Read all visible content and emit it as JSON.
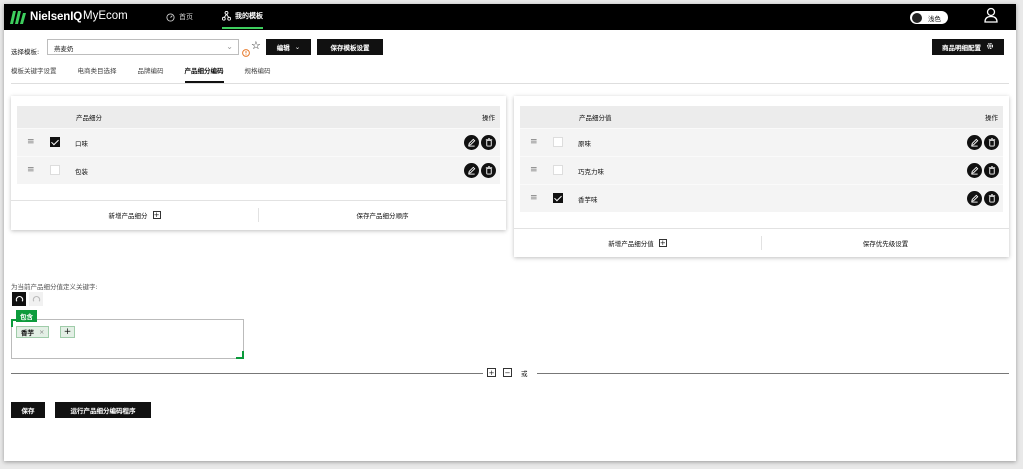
{
  "topbar": {
    "logo_text": "NielsenIQ",
    "app_name": "MyEcom",
    "nav_home": "首页",
    "nav_my_templates": "我的模板",
    "theme_toggle": "浅色"
  },
  "template": {
    "select_label": "选择模板:",
    "selected_value": "燕麦奶",
    "edit_button": "编辑",
    "save_template_settings": "保存模板设置",
    "product_detail_config": "商品明细配置"
  },
  "tabs": [
    {
      "label": "模板关键字设置",
      "active": false
    },
    {
      "label": "电商类目选择",
      "active": false
    },
    {
      "label": "品牌编码",
      "active": false
    },
    {
      "label": "产品细分编码",
      "active": true
    },
    {
      "label": "规格编码",
      "active": false
    }
  ],
  "left_panel": {
    "header_name": "产品细分",
    "header_action": "操作",
    "rows": [
      {
        "name": "口味",
        "checked": true
      },
      {
        "name": "包装",
        "checked": false
      }
    ],
    "add_button": "新增产品细分",
    "save_button": "保存产品细分顺序"
  },
  "right_panel": {
    "header_name": "产品细分值",
    "header_action": "操作",
    "rows": [
      {
        "name": "原味",
        "checked": false
      },
      {
        "name": "巧克力味",
        "checked": false
      },
      {
        "name": "香芋味",
        "checked": true
      }
    ],
    "add_button": "新增产品细分值",
    "save_button": "保存优先级设置"
  },
  "keywords": {
    "label": "为当前产品细分值定义关键字:",
    "contain_tag": "包含",
    "chips": [
      "香芋"
    ],
    "add_chip": "+",
    "or_label": "或"
  },
  "footer": {
    "save_button": "保存",
    "run_button": "运行产品细分编码程序"
  },
  "colors": {
    "accent_green": "#0d9b3c",
    "topbar": "#000000"
  }
}
